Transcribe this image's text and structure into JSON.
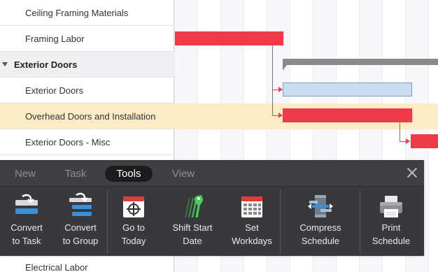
{
  "tasks": [
    {
      "label": "Ceiling Framing Materials"
    },
    {
      "label": "Framing Labor"
    },
    {
      "label": "Exterior Doors"
    },
    {
      "label": "Exterior Doors"
    },
    {
      "label": "Overhead Doors and Installation"
    },
    {
      "label": "Exterior Doors - Misc"
    },
    {
      "label": "Electrical Labor"
    }
  ],
  "toolbar": {
    "tabs": [
      {
        "label": "New"
      },
      {
        "label": "Task"
      },
      {
        "label": "Tools"
      },
      {
        "label": "View"
      }
    ],
    "active_tab": "Tools",
    "tools": [
      {
        "label": "Convert\nto Task",
        "icon": "convert-to-task-icon"
      },
      {
        "label": "Convert\nto Group",
        "icon": "convert-to-group-icon"
      },
      {
        "label": "Go to\nToday",
        "icon": "calendar-target-icon"
      },
      {
        "label": "Shift Start\nDate",
        "icon": "shift-start-date-icon"
      },
      {
        "label": "Set\nWorkdays",
        "icon": "calendar-grid-icon"
      },
      {
        "label": "Compress\nSchedule",
        "icon": "compress-schedule-icon"
      },
      {
        "label": "Print\nSchedule",
        "icon": "printer-icon"
      }
    ]
  },
  "colors": {
    "task_bar": "#f03a47",
    "task_bar_light": "#c9dcf0",
    "summary_bar": "#8a8a8a",
    "selection": "#fdebc6",
    "toolbar_bg": "#404042",
    "tool_accent_blue": "#3a8fd9",
    "tool_accent_red": "#e03a3a",
    "tool_accent_green": "#3fb34f"
  }
}
